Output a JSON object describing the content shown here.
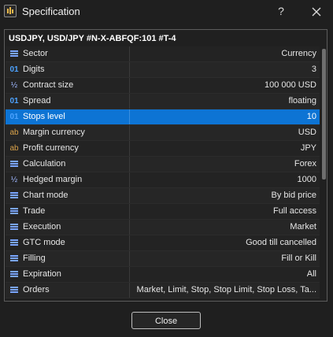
{
  "window": {
    "title": "Specification",
    "help_label": "?",
    "close_icon": "close-icon"
  },
  "header": {
    "symbol": "USDJPY, USD/JPY #N-X-ABFQF:101 #T-4"
  },
  "rows": [
    {
      "icon": "list-icon",
      "label": "Sector",
      "value": "Currency"
    },
    {
      "icon": "digits-icon",
      "label": "Digits",
      "value": "3"
    },
    {
      "icon": "fraction-icon",
      "label": "Contract size",
      "value": "100 000 USD"
    },
    {
      "icon": "digits-icon",
      "label": "Spread",
      "value": "floating"
    },
    {
      "icon": "digits-icon",
      "label": "Stops level",
      "value": "10",
      "selected": true
    },
    {
      "icon": "text-icon",
      "label": "Margin currency",
      "value": "USD"
    },
    {
      "icon": "text-icon",
      "label": "Profit currency",
      "value": "JPY"
    },
    {
      "icon": "list-icon",
      "label": "Calculation",
      "value": "Forex"
    },
    {
      "icon": "fraction-icon",
      "label": "Hedged margin",
      "value": "1000"
    },
    {
      "icon": "list-icon",
      "label": "Chart mode",
      "value": "By bid price"
    },
    {
      "icon": "list-icon",
      "label": "Trade",
      "value": "Full access"
    },
    {
      "icon": "list-icon",
      "label": "Execution",
      "value": "Market"
    },
    {
      "icon": "list-icon",
      "label": "GTC mode",
      "value": "Good till cancelled"
    },
    {
      "icon": "list-icon",
      "label": "Filling",
      "value": "Fill or Kill"
    },
    {
      "icon": "list-icon",
      "label": "Expiration",
      "value": "All"
    },
    {
      "icon": "list-icon",
      "label": "Orders",
      "value": "Market, Limit, Stop, Stop Limit, Stop Loss, Ta..."
    }
  ],
  "footer": {
    "close_label": "Close"
  },
  "colors": {
    "selection": "#0d74d4",
    "background": "#1f1f1f"
  }
}
